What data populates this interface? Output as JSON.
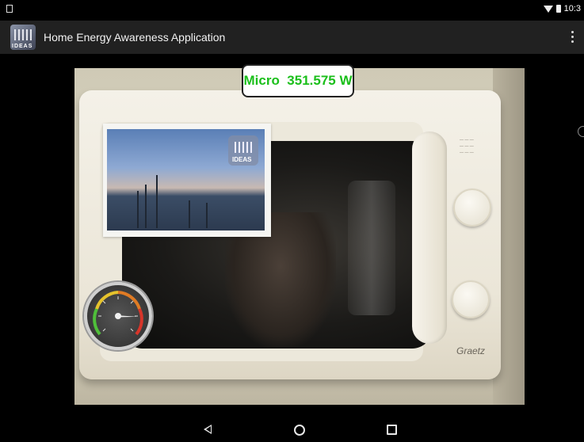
{
  "status_bar": {
    "time": "10:3"
  },
  "app_bar": {
    "title": "Home Energy Awareness Application"
  },
  "ar_overlay": {
    "appliance": "Micro",
    "power_reading": "351.575 W"
  },
  "microwave": {
    "brand": "Graetz"
  },
  "gauge": {
    "level": 0.85
  }
}
